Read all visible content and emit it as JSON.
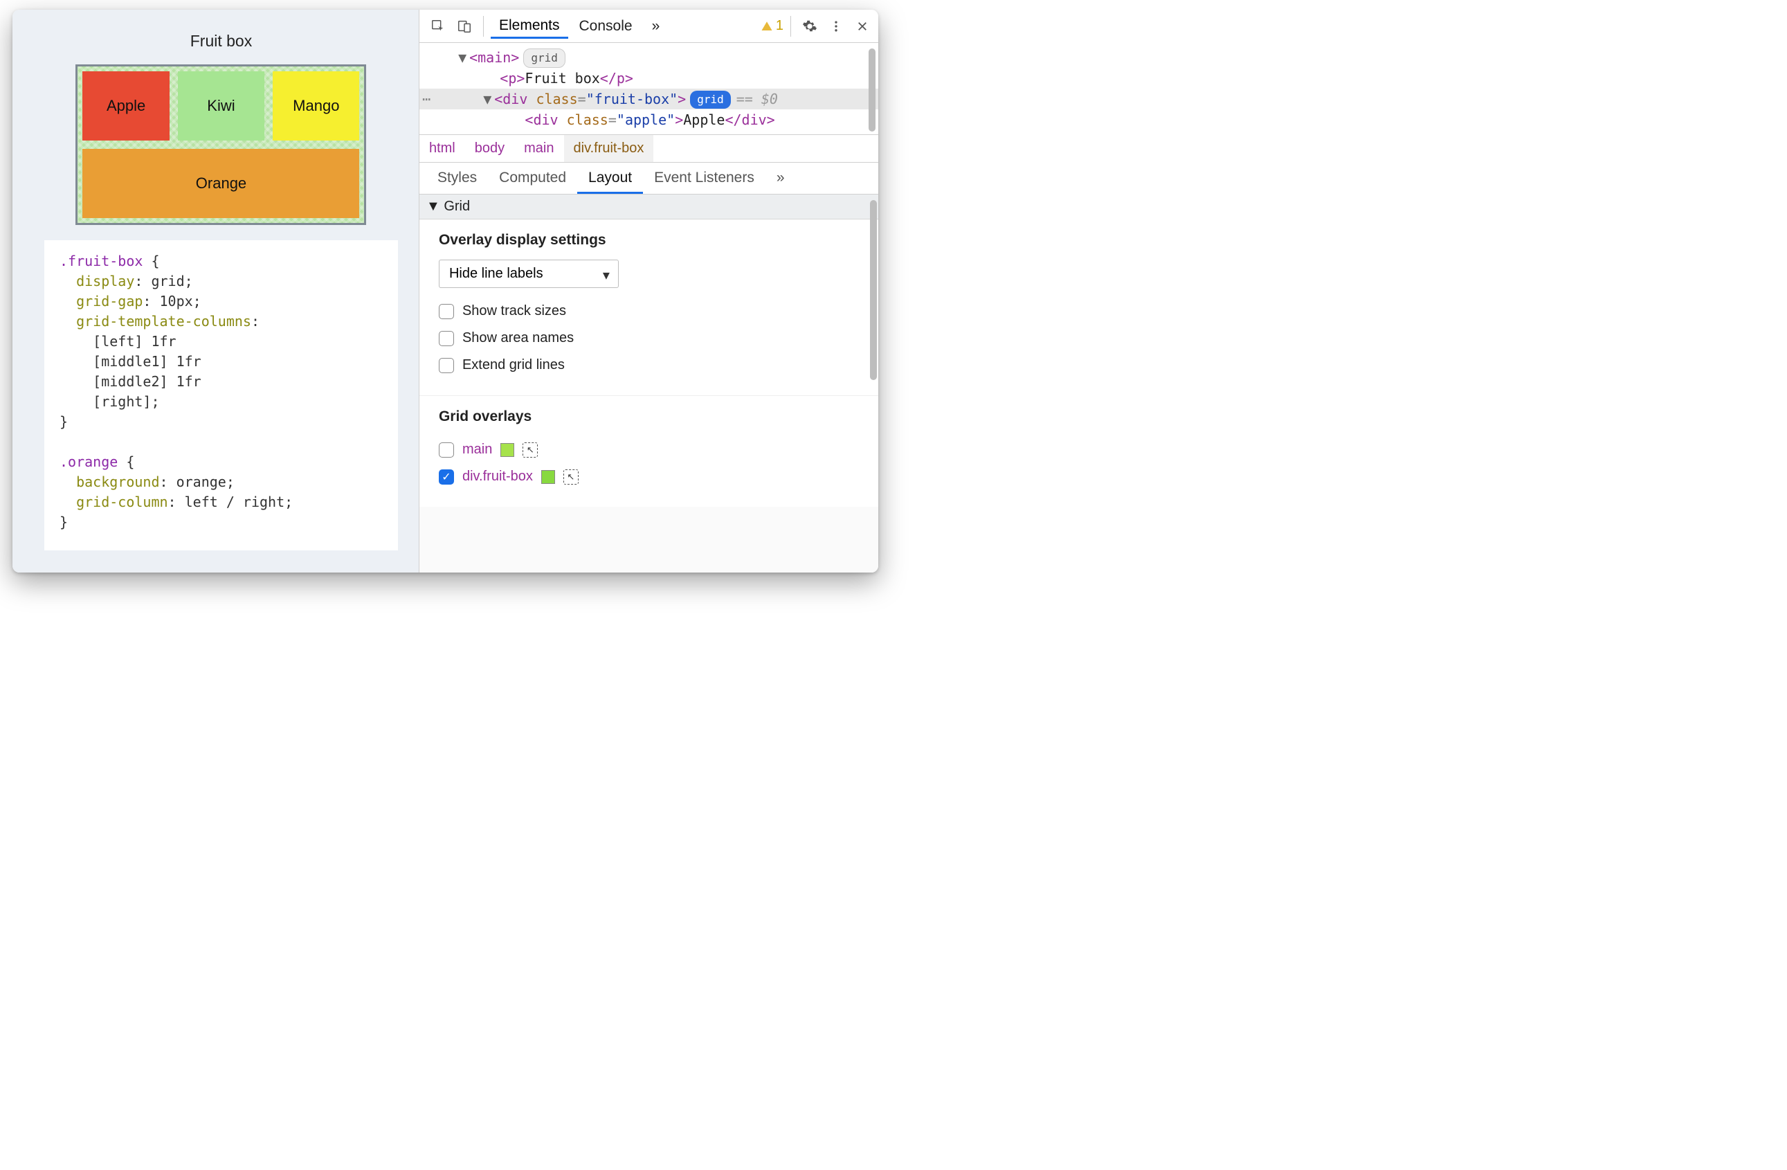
{
  "page": {
    "title": "Fruit box",
    "fruits": {
      "apple": "Apple",
      "kiwi": "Kiwi",
      "mango": "Mango",
      "orange": "Orange"
    },
    "css": ".fruit-box {\n  display: grid;\n  grid-gap: 10px;\n  grid-template-columns:\n    [left] 1fr\n    [middle1] 1fr\n    [middle2] 1fr\n    [right];\n}\n\n.orange {\n  background: orange;\n  grid-column: left / right;\n}"
  },
  "devtools": {
    "tabs": {
      "elements": "Elements",
      "console": "Console",
      "more": "»"
    },
    "warning_count": "1",
    "dom": {
      "main_open": "<main>",
      "main_badge": "grid",
      "p_line": "<p>Fruit box</p>",
      "div_open_prefix": "<div ",
      "div_attr_name": "class",
      "div_attr_val": "\"fruit-box\"",
      "div_open_suffix": ">",
      "div_badge": "grid",
      "sel_suffix": "== $0",
      "apple_line_prefix": "<div ",
      "apple_attr_name": "class",
      "apple_attr_val": "\"apple\"",
      "apple_mid": ">",
      "apple_text": "Apple",
      "apple_close": "</div>"
    },
    "crumbs": [
      "html",
      "body",
      "main",
      "div.fruit-box"
    ],
    "subtabs": {
      "styles": "Styles",
      "computed": "Computed",
      "layout": "Layout",
      "listeners": "Event Listeners",
      "more": "»"
    },
    "layout": {
      "section": "Grid",
      "overlay_settings_title": "Overlay display settings",
      "select_value": "Hide line labels",
      "opts": {
        "track_sizes": "Show track sizes",
        "area_names": "Show area names",
        "extend_lines": "Extend grid lines"
      },
      "overlays_title": "Grid overlays",
      "overlays": [
        {
          "name": "main",
          "checked": false,
          "color": "#a6e24b"
        },
        {
          "name": "div.fruit-box",
          "checked": true,
          "color": "#88d93f"
        }
      ]
    }
  }
}
